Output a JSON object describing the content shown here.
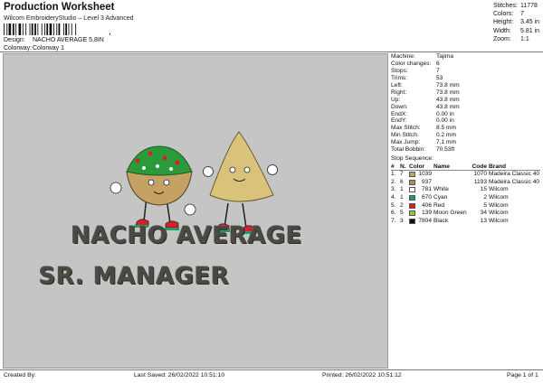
{
  "header": {
    "title": "Production Worksheet",
    "subtitle": "Wilcom EmbroideryStudio – Level 3 Advanced",
    "barcode_suffix": ",",
    "design_label": "Design:",
    "design_value": "NACHO AVERAGE 5,8IN",
    "colorway_label": "Colorway:",
    "colorway_value": "Colorway 1"
  },
  "stats": [
    {
      "label": "Stitches:",
      "value": "11778"
    },
    {
      "label": "Colors:",
      "value": "7"
    },
    {
      "label": "Height:",
      "value": "3.45 in"
    },
    {
      "label": "Width:",
      "value": "5.81 in"
    },
    {
      "label": "Zoom:",
      "value": "1:1"
    }
  ],
  "design": {
    "line1": "NACHO AVERAGE",
    "line2": "SR. MANAGER"
  },
  "machine_info": [
    {
      "label": "Machine:",
      "value": "Tajima"
    },
    {
      "label": "Color changes:",
      "value": "6"
    },
    {
      "label": "Stops:",
      "value": "7"
    },
    {
      "label": "Trims:",
      "value": "53"
    },
    {
      "label": "Left:",
      "value": "73.8 mm"
    },
    {
      "label": "Right:",
      "value": "73.8 mm"
    },
    {
      "label": "Up:",
      "value": "43.8 mm"
    },
    {
      "label": "Down:",
      "value": "43.8 mm"
    },
    {
      "label": "EndX:",
      "value": "0.00 in"
    },
    {
      "label": "EndY:",
      "value": "0.00 in"
    },
    {
      "label": "Max Stitch:",
      "value": "8.5 mm"
    },
    {
      "label": "Min Stitch:",
      "value": "0.2 mm"
    },
    {
      "label": "Max Jump:",
      "value": "7.1 mm"
    },
    {
      "label": "Total Bobbin:",
      "value": "70.53ft"
    }
  ],
  "stop_sequence": {
    "title": "Stop Sequence:",
    "headers": {
      "num": "#",
      "n": "N.",
      "color": "Color",
      "name": "Name",
      "code": "Code",
      "brand": "Brand"
    },
    "rows": [
      {
        "num": "1.",
        "n": "7",
        "swatch": "#c8a060",
        "code": "1039",
        "name": "",
        "code2": "1070",
        "brand": "Madeira Classic 40"
      },
      {
        "num": "2.",
        "n": "6",
        "swatch": "#b08a58",
        "code": "937",
        "name": "",
        "code2": "1193",
        "brand": "Madeira Classic 40"
      },
      {
        "num": "3.",
        "n": "1",
        "swatch": "#ffffff",
        "code": "781",
        "name": "White",
        "code2": "15",
        "brand": "Wilcom"
      },
      {
        "num": "4.",
        "n": "1",
        "swatch": "#1aa060",
        "code": "670",
        "name": "Cyan",
        "code2": "2",
        "brand": "Wilcom"
      },
      {
        "num": "5.",
        "n": "2",
        "swatch": "#d8202a",
        "code": "406",
        "name": "Red",
        "code2": "5",
        "brand": "Wilcom"
      },
      {
        "num": "6.",
        "n": "5",
        "swatch": "#9cc23a",
        "code": "139",
        "name": "Moon Green",
        "code2": "34",
        "brand": "Wilcom"
      },
      {
        "num": "7.",
        "n": "3",
        "swatch": "#111111",
        "code": "7804",
        "name": "Black",
        "code2": "13",
        "brand": "Wilcom"
      }
    ]
  },
  "footer": {
    "created_by": "Created By:",
    "last_saved": "Last Saved: 26/02/2022 10:51:10",
    "printed": "Printed: 26/02/2022 10:51:12",
    "page": "Page 1 of 1"
  }
}
